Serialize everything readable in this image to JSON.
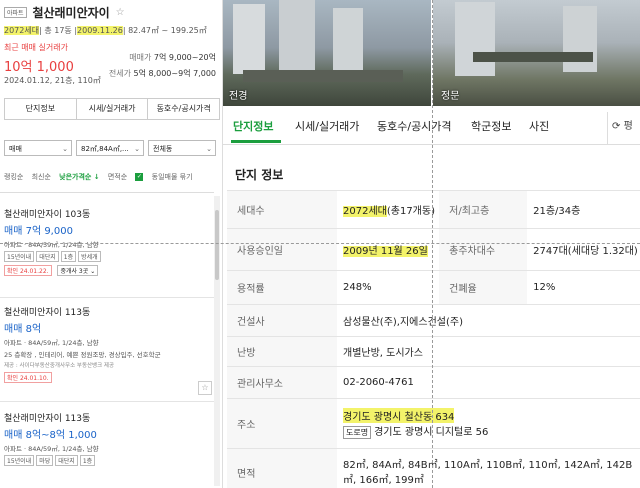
{
  "complex": {
    "badge": "아파트",
    "name": "철산래미안자이",
    "units": "2072세대",
    "buildings": " 총 17동 ",
    "approval_date": "2009.11.26",
    "area": " 82.47㎡ ~ 199.25㎡"
  },
  "price": {
    "label": "최근 매매 실거래가",
    "value": "10억 1,000",
    "date": "2024.01.12, 21층, 110㎡",
    "sale_key": "매매가",
    "sale_range": "7억 9,000~20억",
    "lease_key": "전세가",
    "lease_range": "5억 8,000~9억 7,000"
  },
  "left_tabs": [
    "단지정보",
    "시세/실거래가",
    "동호수/공시가격"
  ],
  "filters": {
    "trade": "매매",
    "area": "82㎡,84A㎡,...",
    "building": "전체동"
  },
  "sort": {
    "items": [
      "랭킹순",
      "최신순",
      "낮은가격순 ↓",
      "면적순"
    ],
    "group_label": "동일매물 묶기"
  },
  "listings": [
    {
      "title": "철산래미안자이 103동",
      "price": "매매 7억 9,000",
      "spec": "아파트 · 84A/59㎡, 1/24층, 남향",
      "tags": [
        "15년이내",
        "대단지",
        "1층",
        "방세개"
      ],
      "confirm": "확인 24.01.22.",
      "agent": "중개사 3곳"
    },
    {
      "title": "철산래미안자이 113동",
      "price": "매매 8억",
      "spec": "아파트 · 84A/59㎡, 1/24층, 남향",
      "desc": "25 층확장 , 인테리어, 예쁜 정원조망, 경상입주, 선호학군",
      "agency": "제공 : 사이다부동산중개사무소   부동산뱅크 제공",
      "confirm": "확인 24.01.10."
    },
    {
      "title": "철산래미안자이 113동",
      "price": "매매 8억~8억 1,000",
      "spec": "아파트 · 84A/59㎡, 1/24층, 남향",
      "tags": [
        "15년이내",
        "마당",
        "대단지",
        "1층"
      ]
    }
  ],
  "photos": {
    "left_label": "전경",
    "right_label": "정문"
  },
  "right_tabs": [
    "단지정보",
    "시세/실거래가",
    "동호수/공시가격",
    "학군정보",
    "사진"
  ],
  "right_more": "평",
  "section_title": "단지 정보",
  "info": {
    "units_label": "세대수",
    "units_value": "2072세대",
    "units_suffix": "(총17개동)",
    "floors_label": "저/최고층",
    "floors_value": "21층/34층",
    "approval_label": "사용승인일",
    "approval_value": "2009년 11월 26일",
    "parking_label": "총주차대수",
    "parking_value": "2747대(세대당 1.32대)",
    "far_label": "용적률",
    "far_value": "248%",
    "bcr_label": "건폐율",
    "bcr_value": "12%",
    "builder_label": "건설사",
    "builder_value": "삼성물산(주),지에스건설(주)",
    "heating_label": "난방",
    "heating_value": "개별난방, 도시가스",
    "office_label": "관리사무소",
    "office_value": "02-2060-4761",
    "address_label": "주소",
    "address_lot": "경기도 광명시 철산동 634",
    "road_badge": "도로명",
    "address_road": "경기도 광명시 디지털로 56",
    "area_label": "면적",
    "area_value": "82㎡, 84A㎡, 84B㎡, 110A㎡, 110B㎡, 110㎡, 142A㎡, 142B㎡, 166㎡, 199㎡"
  }
}
